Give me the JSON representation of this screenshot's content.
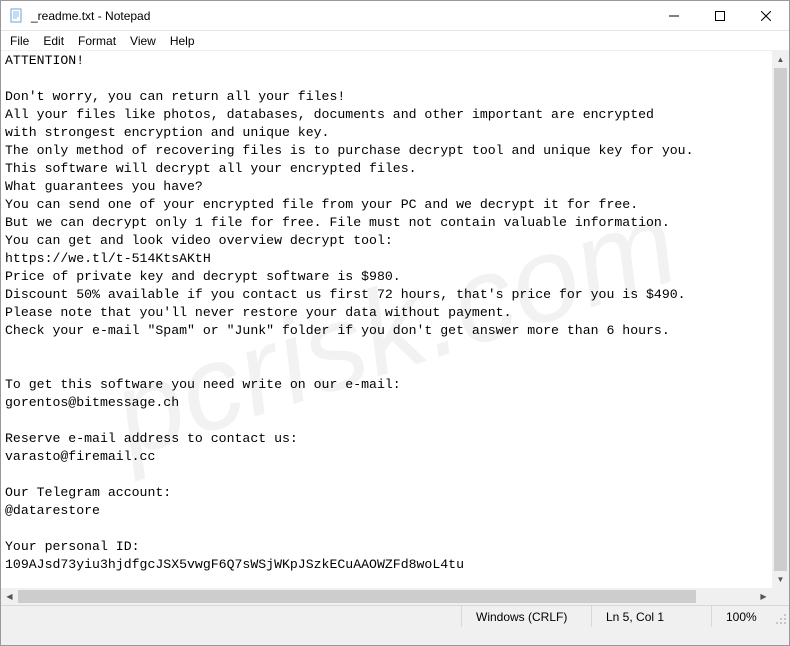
{
  "window": {
    "title": "_readme.txt - Notepad"
  },
  "menu": {
    "file": "File",
    "edit": "Edit",
    "format": "Format",
    "view": "View",
    "help": "Help"
  },
  "document": {
    "text": "ATTENTION!\n\nDon't worry, you can return all your files!\nAll your files like photos, databases, documents and other important are encrypted\nwith strongest encryption and unique key.\nThe only method of recovering files is to purchase decrypt tool and unique key for you.\nThis software will decrypt all your encrypted files.\nWhat guarantees you have?\nYou can send one of your encrypted file from your PC and we decrypt it for free.\nBut we can decrypt only 1 file for free. File must not contain valuable information.\nYou can get and look video overview decrypt tool:\nhttps://we.tl/t-514KtsAKtH\nPrice of private key and decrypt software is $980.\nDiscount 50% available if you contact us first 72 hours, that's price for you is $490.\nPlease note that you'll never restore your data without payment.\nCheck your e-mail \"Spam\" or \"Junk\" folder if you don't get answer more than 6 hours.\n\n\nTo get this software you need write on our e-mail:\ngorentos@bitmessage.ch\n\nReserve e-mail address to contact us:\nvarasto@firemail.cc\n\nOur Telegram account:\n@datarestore\n\nYour personal ID:\n109AJsd73yiu3hjdfgcJSX5vwgF6Q7sWSjWKpJSzkECuAAOWZFd8woL4tu"
  },
  "status": {
    "encoding": "Windows (CRLF)",
    "position": "Ln 5, Col 1",
    "zoom": "100%"
  }
}
